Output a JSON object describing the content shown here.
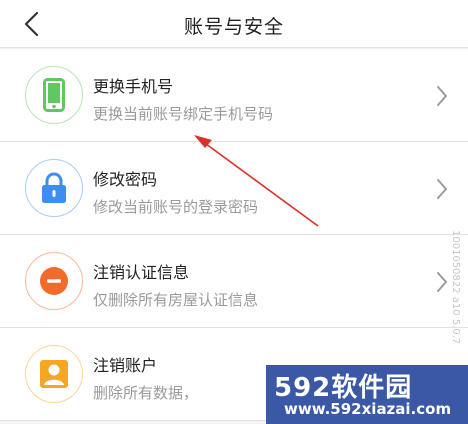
{
  "header": {
    "title": "账号与安全",
    "back_icon": "chevron-left-icon"
  },
  "colors": {
    "phone_green": "#5fc95f",
    "lock_blue": "#3d8ef0",
    "cancel_red": "#f26b2a",
    "account_orange": "#f5a623",
    "annotation_arrow": "#d9302a",
    "watermark_bg": "#3b58a6"
  },
  "items": [
    {
      "title": "更换手机号",
      "subtitle": "更换当前账号绑定手机号码",
      "icon": "smartphone-icon"
    },
    {
      "title": "修改密码",
      "subtitle": "修改当前账号的登录密码",
      "icon": "lock-icon"
    },
    {
      "title": "注销认证信息",
      "subtitle": "仅删除所有房屋认证信息",
      "icon": "minus-circle-icon"
    },
    {
      "title": "注销账户",
      "subtitle": "删除所有数据，",
      "icon": "user-icon"
    }
  ],
  "side_id": "1001050822 a10 5.0.7",
  "watermark": {
    "line1": "592软件园",
    "line2": "www.592xiazai.com"
  }
}
